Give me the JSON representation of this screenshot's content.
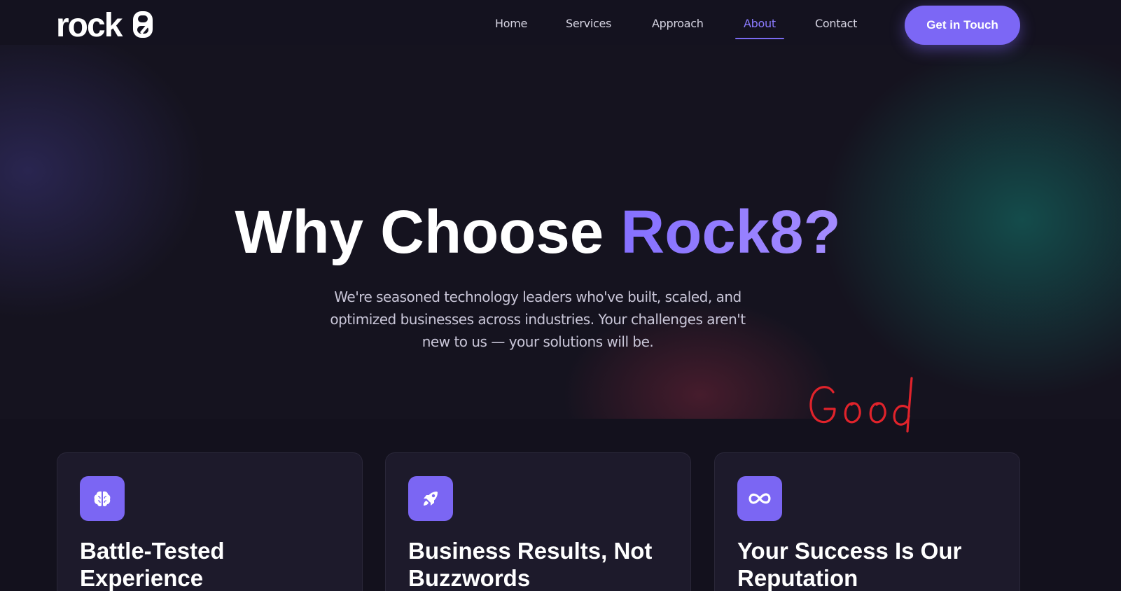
{
  "header": {
    "logo_text": "rock8",
    "nav": [
      {
        "label": "Home",
        "active": false
      },
      {
        "label": "Services",
        "active": false
      },
      {
        "label": "Approach",
        "active": false
      },
      {
        "label": "About",
        "active": true
      },
      {
        "label": "Contact",
        "active": false
      }
    ],
    "cta_label": "Get in Touch"
  },
  "hero": {
    "title_prefix": "Why Choose ",
    "title_accent": "Rock8?",
    "subtitle": "We're seasoned technology leaders who've built, scaled, and optimized businesses across industries. Your challenges aren't new to us — your solutions will be."
  },
  "annotation": {
    "text": "Good",
    "color": "#e0232b"
  },
  "cards": [
    {
      "icon": "brain-icon",
      "title": "Battle-Tested Experience"
    },
    {
      "icon": "rocket-icon",
      "title": "Business Results, Not Buzzwords"
    },
    {
      "icon": "infinity-icon",
      "title": "Your Success Is Our Reputation"
    }
  ],
  "colors": {
    "background": "#13111d",
    "accent": "#7c67f5",
    "nav_active": "#8b7bff",
    "card_background": "#1d1a2b"
  }
}
